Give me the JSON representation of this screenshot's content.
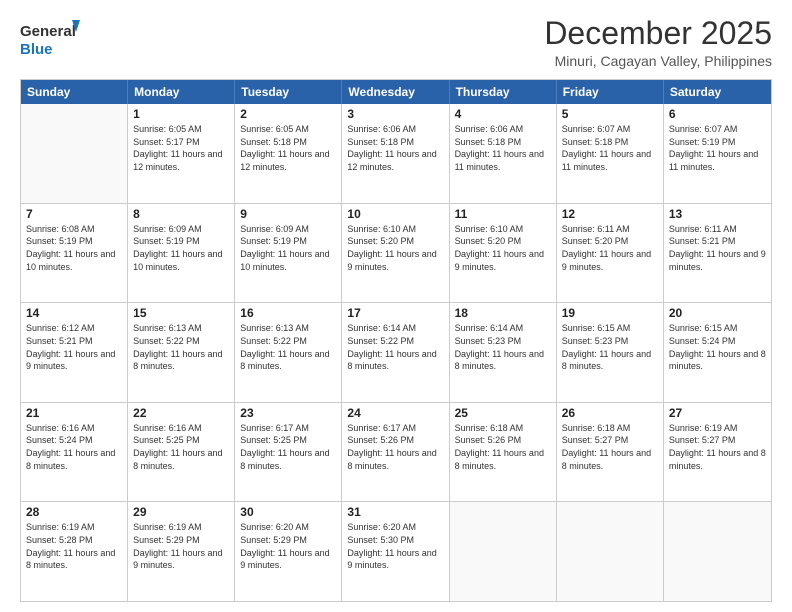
{
  "logo": {
    "line1": "General",
    "line2": "Blue"
  },
  "title": "December 2025",
  "subtitle": "Minuri, Cagayan Valley, Philippines",
  "days_of_week": [
    "Sunday",
    "Monday",
    "Tuesday",
    "Wednesday",
    "Thursday",
    "Friday",
    "Saturday"
  ],
  "weeks": [
    [
      {
        "day": "",
        "sunrise": "",
        "sunset": "",
        "daylight": ""
      },
      {
        "day": "1",
        "sunrise": "Sunrise: 6:05 AM",
        "sunset": "Sunset: 5:17 PM",
        "daylight": "Daylight: 11 hours and 12 minutes."
      },
      {
        "day": "2",
        "sunrise": "Sunrise: 6:05 AM",
        "sunset": "Sunset: 5:18 PM",
        "daylight": "Daylight: 11 hours and 12 minutes."
      },
      {
        "day": "3",
        "sunrise": "Sunrise: 6:06 AM",
        "sunset": "Sunset: 5:18 PM",
        "daylight": "Daylight: 11 hours and 12 minutes."
      },
      {
        "day": "4",
        "sunrise": "Sunrise: 6:06 AM",
        "sunset": "Sunset: 5:18 PM",
        "daylight": "Daylight: 11 hours and 11 minutes."
      },
      {
        "day": "5",
        "sunrise": "Sunrise: 6:07 AM",
        "sunset": "Sunset: 5:18 PM",
        "daylight": "Daylight: 11 hours and 11 minutes."
      },
      {
        "day": "6",
        "sunrise": "Sunrise: 6:07 AM",
        "sunset": "Sunset: 5:19 PM",
        "daylight": "Daylight: 11 hours and 11 minutes."
      }
    ],
    [
      {
        "day": "7",
        "sunrise": "Sunrise: 6:08 AM",
        "sunset": "Sunset: 5:19 PM",
        "daylight": "Daylight: 11 hours and 10 minutes."
      },
      {
        "day": "8",
        "sunrise": "Sunrise: 6:09 AM",
        "sunset": "Sunset: 5:19 PM",
        "daylight": "Daylight: 11 hours and 10 minutes."
      },
      {
        "day": "9",
        "sunrise": "Sunrise: 6:09 AM",
        "sunset": "Sunset: 5:19 PM",
        "daylight": "Daylight: 11 hours and 10 minutes."
      },
      {
        "day": "10",
        "sunrise": "Sunrise: 6:10 AM",
        "sunset": "Sunset: 5:20 PM",
        "daylight": "Daylight: 11 hours and 9 minutes."
      },
      {
        "day": "11",
        "sunrise": "Sunrise: 6:10 AM",
        "sunset": "Sunset: 5:20 PM",
        "daylight": "Daylight: 11 hours and 9 minutes."
      },
      {
        "day": "12",
        "sunrise": "Sunrise: 6:11 AM",
        "sunset": "Sunset: 5:20 PM",
        "daylight": "Daylight: 11 hours and 9 minutes."
      },
      {
        "day": "13",
        "sunrise": "Sunrise: 6:11 AM",
        "sunset": "Sunset: 5:21 PM",
        "daylight": "Daylight: 11 hours and 9 minutes."
      }
    ],
    [
      {
        "day": "14",
        "sunrise": "Sunrise: 6:12 AM",
        "sunset": "Sunset: 5:21 PM",
        "daylight": "Daylight: 11 hours and 9 minutes."
      },
      {
        "day": "15",
        "sunrise": "Sunrise: 6:13 AM",
        "sunset": "Sunset: 5:22 PM",
        "daylight": "Daylight: 11 hours and 8 minutes."
      },
      {
        "day": "16",
        "sunrise": "Sunrise: 6:13 AM",
        "sunset": "Sunset: 5:22 PM",
        "daylight": "Daylight: 11 hours and 8 minutes."
      },
      {
        "day": "17",
        "sunrise": "Sunrise: 6:14 AM",
        "sunset": "Sunset: 5:22 PM",
        "daylight": "Daylight: 11 hours and 8 minutes."
      },
      {
        "day": "18",
        "sunrise": "Sunrise: 6:14 AM",
        "sunset": "Sunset: 5:23 PM",
        "daylight": "Daylight: 11 hours and 8 minutes."
      },
      {
        "day": "19",
        "sunrise": "Sunrise: 6:15 AM",
        "sunset": "Sunset: 5:23 PM",
        "daylight": "Daylight: 11 hours and 8 minutes."
      },
      {
        "day": "20",
        "sunrise": "Sunrise: 6:15 AM",
        "sunset": "Sunset: 5:24 PM",
        "daylight": "Daylight: 11 hours and 8 minutes."
      }
    ],
    [
      {
        "day": "21",
        "sunrise": "Sunrise: 6:16 AM",
        "sunset": "Sunset: 5:24 PM",
        "daylight": "Daylight: 11 hours and 8 minutes."
      },
      {
        "day": "22",
        "sunrise": "Sunrise: 6:16 AM",
        "sunset": "Sunset: 5:25 PM",
        "daylight": "Daylight: 11 hours and 8 minutes."
      },
      {
        "day": "23",
        "sunrise": "Sunrise: 6:17 AM",
        "sunset": "Sunset: 5:25 PM",
        "daylight": "Daylight: 11 hours and 8 minutes."
      },
      {
        "day": "24",
        "sunrise": "Sunrise: 6:17 AM",
        "sunset": "Sunset: 5:26 PM",
        "daylight": "Daylight: 11 hours and 8 minutes."
      },
      {
        "day": "25",
        "sunrise": "Sunrise: 6:18 AM",
        "sunset": "Sunset: 5:26 PM",
        "daylight": "Daylight: 11 hours and 8 minutes."
      },
      {
        "day": "26",
        "sunrise": "Sunrise: 6:18 AM",
        "sunset": "Sunset: 5:27 PM",
        "daylight": "Daylight: 11 hours and 8 minutes."
      },
      {
        "day": "27",
        "sunrise": "Sunrise: 6:19 AM",
        "sunset": "Sunset: 5:27 PM",
        "daylight": "Daylight: 11 hours and 8 minutes."
      }
    ],
    [
      {
        "day": "28",
        "sunrise": "Sunrise: 6:19 AM",
        "sunset": "Sunset: 5:28 PM",
        "daylight": "Daylight: 11 hours and 8 minutes."
      },
      {
        "day": "29",
        "sunrise": "Sunrise: 6:19 AM",
        "sunset": "Sunset: 5:29 PM",
        "daylight": "Daylight: 11 hours and 9 minutes."
      },
      {
        "day": "30",
        "sunrise": "Sunrise: 6:20 AM",
        "sunset": "Sunset: 5:29 PM",
        "daylight": "Daylight: 11 hours and 9 minutes."
      },
      {
        "day": "31",
        "sunrise": "Sunrise: 6:20 AM",
        "sunset": "Sunset: 5:30 PM",
        "daylight": "Daylight: 11 hours and 9 minutes."
      },
      {
        "day": "",
        "sunrise": "",
        "sunset": "",
        "daylight": ""
      },
      {
        "day": "",
        "sunrise": "",
        "sunset": "",
        "daylight": ""
      },
      {
        "day": "",
        "sunrise": "",
        "sunset": "",
        "daylight": ""
      }
    ]
  ]
}
